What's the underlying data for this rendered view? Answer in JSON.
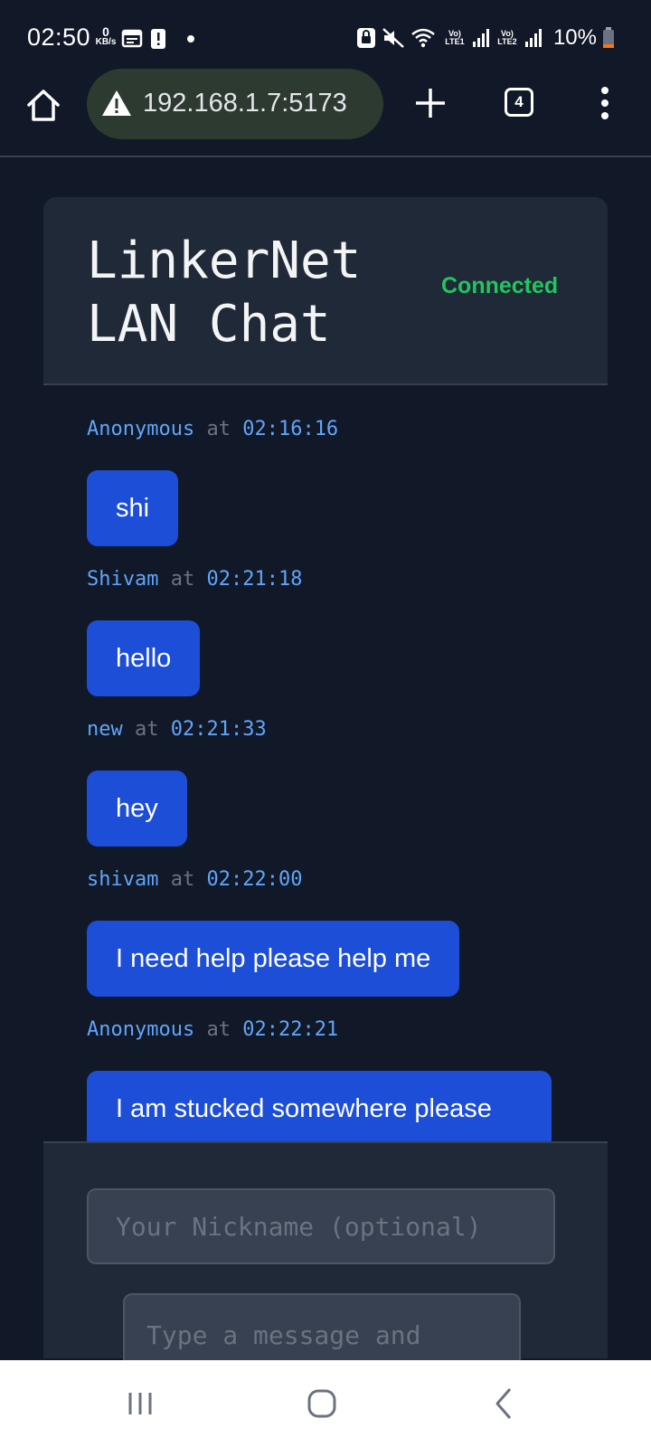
{
  "status_bar": {
    "time": "02:50",
    "net_speed_value": "0",
    "net_speed_unit": "KB/s",
    "sim1_label": "Vo) LTE1",
    "sim2_label": "Vo) LTE2",
    "battery_percent": "10%",
    "battery_level": 0.1,
    "battery_color": "#f97316"
  },
  "browser": {
    "url": "192.168.1.7:5173",
    "tab_count": "4"
  },
  "header": {
    "title": "LinkerNet\nLAN Chat",
    "status": "Connected",
    "status_color": "#22c55e"
  },
  "messages": [
    {
      "user": "Anonymous",
      "at": "at",
      "time": "02:16:16",
      "text": "shi"
    },
    {
      "user": "Shivam",
      "at": "at",
      "time": "02:21:18",
      "text": "hello"
    },
    {
      "user": "new",
      "at": "at",
      "time": "02:21:33",
      "text": "hey"
    },
    {
      "user": "shivam",
      "at": "at",
      "time": "02:22:00",
      "text": "I need help please help me"
    },
    {
      "user": "Anonymous",
      "at": "at",
      "time": "02:22:21",
      "text": "I am stucked somewhere please help me here"
    }
  ],
  "composer": {
    "nickname_placeholder": "Your Nickname (optional)",
    "message_placeholder": "Type a message and"
  },
  "colors": {
    "background": "#111827",
    "card": "#1f2937",
    "bubble": "#1d4ed8",
    "meta_accent": "#60a5fa"
  }
}
